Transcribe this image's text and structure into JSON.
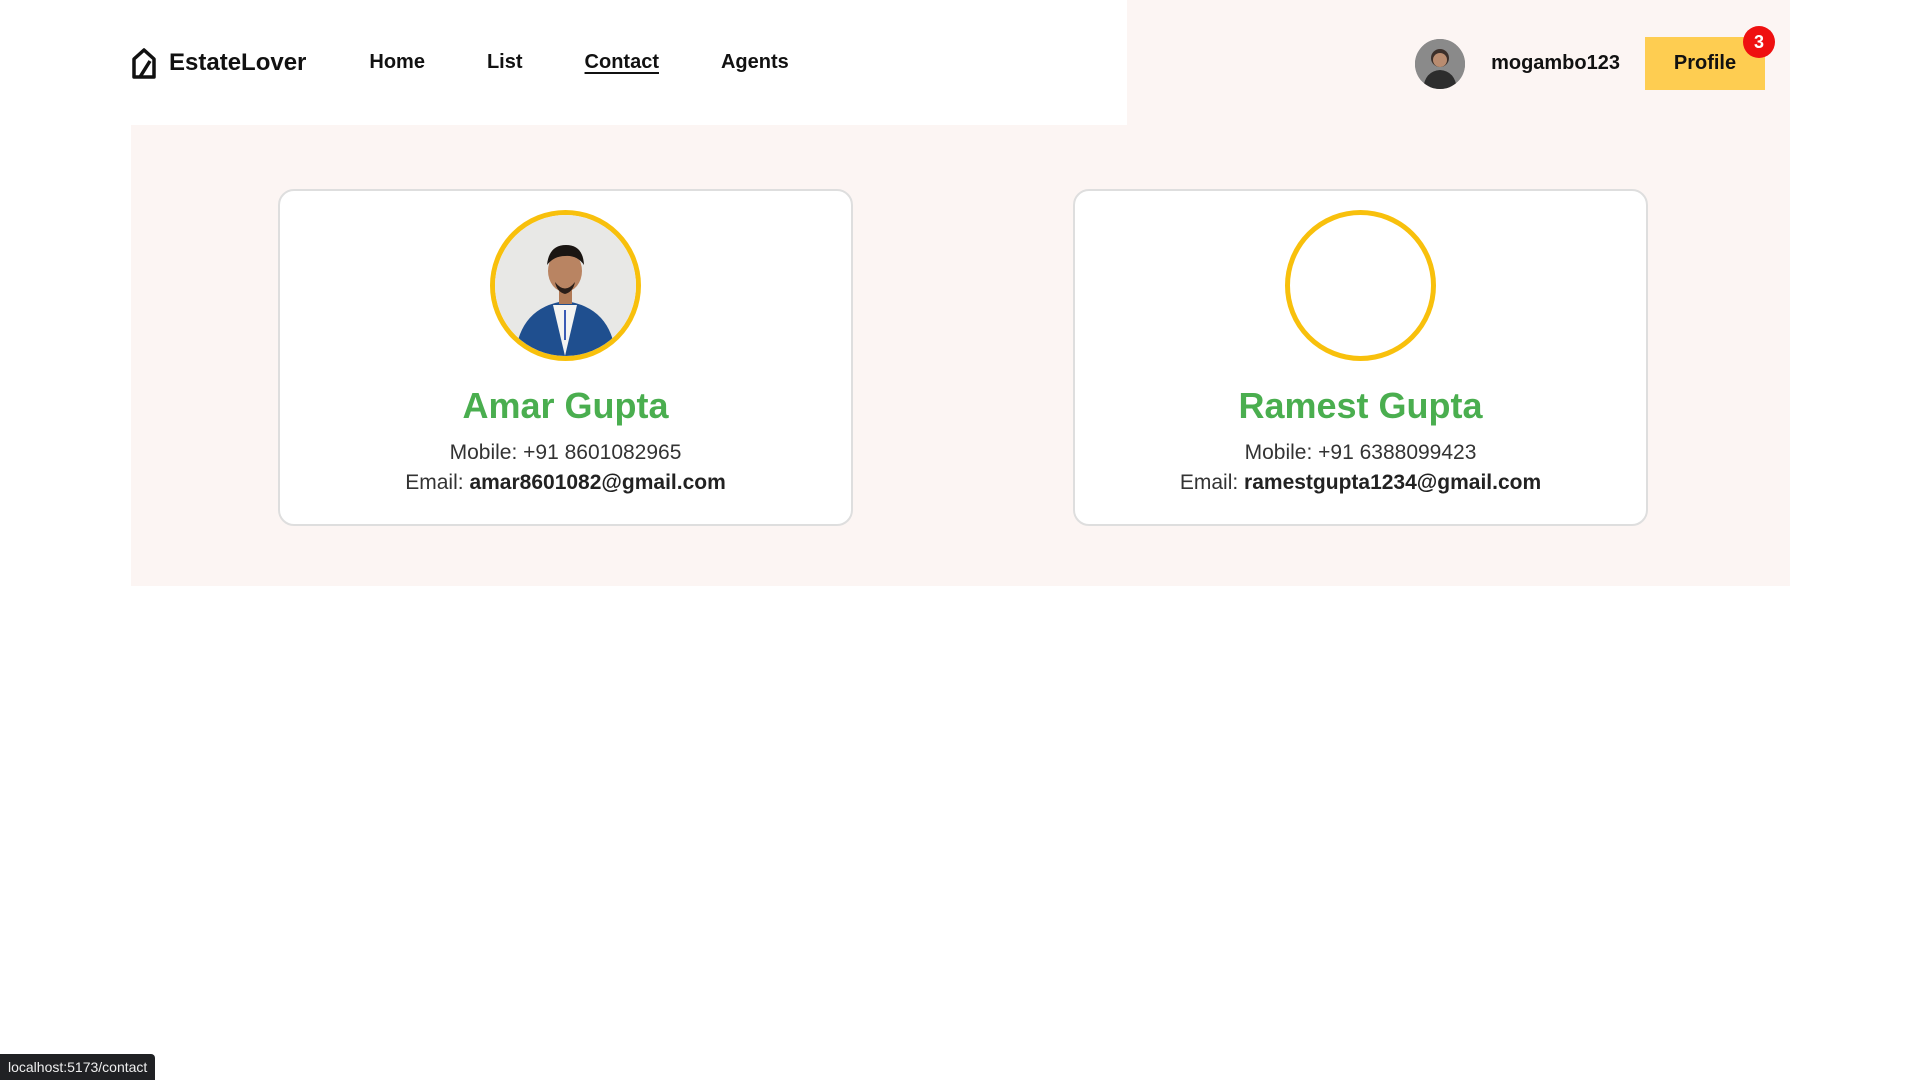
{
  "header": {
    "brand": "EstateLover",
    "nav": [
      {
        "label": "Home",
        "active": false
      },
      {
        "label": "List",
        "active": false
      },
      {
        "label": "Contact",
        "active": true
      },
      {
        "label": "Agents",
        "active": false
      }
    ],
    "username": "mogambo123",
    "profile_label": "Profile",
    "notification_count": "3"
  },
  "contacts": [
    {
      "name": "Amar Gupta",
      "mobile_label": "Mobile:",
      "mobile": "+91 8601082965",
      "email_label": "Email:",
      "email": "amar8601082@gmail.com",
      "has_photo": true
    },
    {
      "name": "Ramest Gupta",
      "mobile_label": "Mobile:",
      "mobile": "+91 6388099423",
      "email_label": "Email:",
      "email": "ramestgupta1234@gmail.com",
      "has_photo": false
    }
  ],
  "status_bar": {
    "url": "localhost:5173/contact"
  },
  "colors": {
    "accent_yellow": "#fecd51",
    "ring_yellow": "#f8c00c",
    "name_green": "#4aae4f",
    "background_pink": "#fcf5f3",
    "badge_red": "#ef1010"
  }
}
